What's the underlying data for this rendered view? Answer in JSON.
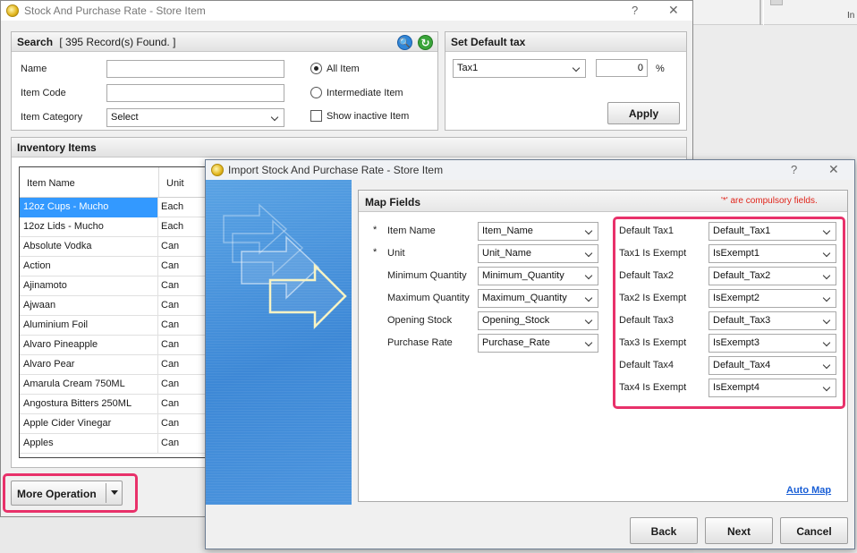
{
  "background_app": {
    "partial_text": "In"
  },
  "window1": {
    "title": "Stock And Purchase Rate - Store Item",
    "help": "?",
    "close": "✕",
    "search": {
      "header": "Search",
      "records": "[ 395 Record(s) Found. ]",
      "name_label": "Name",
      "name_value": "",
      "item_code_label": "Item Code",
      "item_code_value": "",
      "item_category_label": "Item Category",
      "item_category_value": "Select",
      "radio_all": "All Item",
      "radio_intermediate": "Intermediate Item",
      "show_inactive": "Show inactive Item",
      "search_icon_glyph": "🔍",
      "refresh_icon_glyph": "↻"
    },
    "default_tax": {
      "header": "Set Default tax",
      "tax_value": "Tax1",
      "rate_value": "0",
      "percent": "%",
      "apply": "Apply"
    },
    "inventory": {
      "header": "Inventory Items",
      "columns": [
        "Item Name",
        "Unit"
      ],
      "rows": [
        {
          "name": "12oz Cups - Mucho",
          "unit": "Each"
        },
        {
          "name": "12oz Lids - Mucho",
          "unit": "Each"
        },
        {
          "name": "Absolute Vodka",
          "unit": "Can"
        },
        {
          "name": "Action",
          "unit": "Can"
        },
        {
          "name": "Ajinamoto",
          "unit": "Can"
        },
        {
          "name": "Ajwaan",
          "unit": "Can"
        },
        {
          "name": "Aluminium Foil",
          "unit": "Can"
        },
        {
          "name": "Alvaro  Pineapple",
          "unit": "Can"
        },
        {
          "name": "Alvaro Pear",
          "unit": "Can"
        },
        {
          "name": "Amarula Cream 750ML",
          "unit": "Can"
        },
        {
          "name": "Angostura Bitters 250ML",
          "unit": "Can"
        },
        {
          "name": "Apple Cider Vinegar",
          "unit": "Can"
        },
        {
          "name": "Apples",
          "unit": "Can"
        }
      ]
    },
    "more_operation": "More Operation",
    "accent": "#e8316a"
  },
  "window2": {
    "title": "Import Stock And Purchase Rate - Store Item",
    "help": "?",
    "close": "✕",
    "map_fields": {
      "header": "Map Fields",
      "compulsory": "'*' are compulsory fields.",
      "left": [
        {
          "star": "*",
          "label": "Item Name",
          "value": "Item_Name"
        },
        {
          "star": "*",
          "label": "Unit",
          "value": "Unit_Name"
        },
        {
          "star": "",
          "label": "Minimum Quantity",
          "value": "Minimum_Quantity"
        },
        {
          "star": "",
          "label": "Maximum Quantity",
          "value": "Maximum_Quantity"
        },
        {
          "star": "",
          "label": "Opening Stock",
          "value": "Opening_Stock"
        },
        {
          "star": "",
          "label": "Purchase Rate",
          "value": "Purchase_Rate"
        }
      ],
      "right": [
        {
          "label": "Default Tax1",
          "value": "Default_Tax1"
        },
        {
          "label": "Tax1 Is Exempt",
          "value": "IsExempt1"
        },
        {
          "label": "Default Tax2",
          "value": "Default_Tax2"
        },
        {
          "label": "Tax2 Is Exempt",
          "value": "IsExempt2"
        },
        {
          "label": "Default Tax3",
          "value": "Default_Tax3"
        },
        {
          "label": "Tax3 Is Exempt",
          "value": "IsExempt3"
        },
        {
          "label": "Default Tax4",
          "value": "Default_Tax4"
        },
        {
          "label": "Tax4 Is Exempt",
          "value": "IsExempt4"
        }
      ],
      "auto_map": "Auto Map"
    },
    "buttons": {
      "back": "Back",
      "next": "Next",
      "cancel": "Cancel"
    }
  }
}
